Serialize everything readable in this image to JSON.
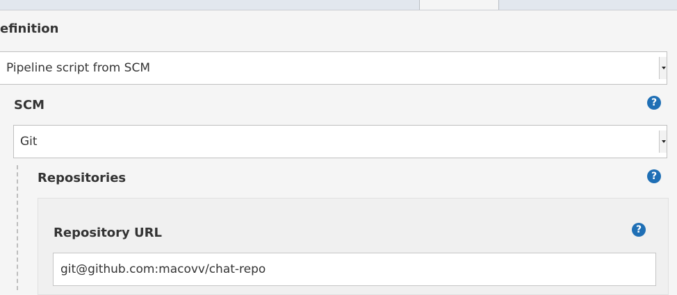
{
  "definition": {
    "label": "efinition",
    "select_value": "Pipeline script from SCM"
  },
  "scm": {
    "label": "SCM",
    "help_glyph": "?",
    "select_value": "Git"
  },
  "repositories": {
    "label": "Repositories",
    "help_glyph": "?",
    "repository_url": {
      "label": "Repository URL",
      "help_glyph": "?",
      "value": "git@github.com:macovv/chat-repo"
    }
  },
  "colors": {
    "help_icon": "#1f6fb5",
    "page_background": "#f5f5f5",
    "topbar": "#e2e7ee"
  }
}
